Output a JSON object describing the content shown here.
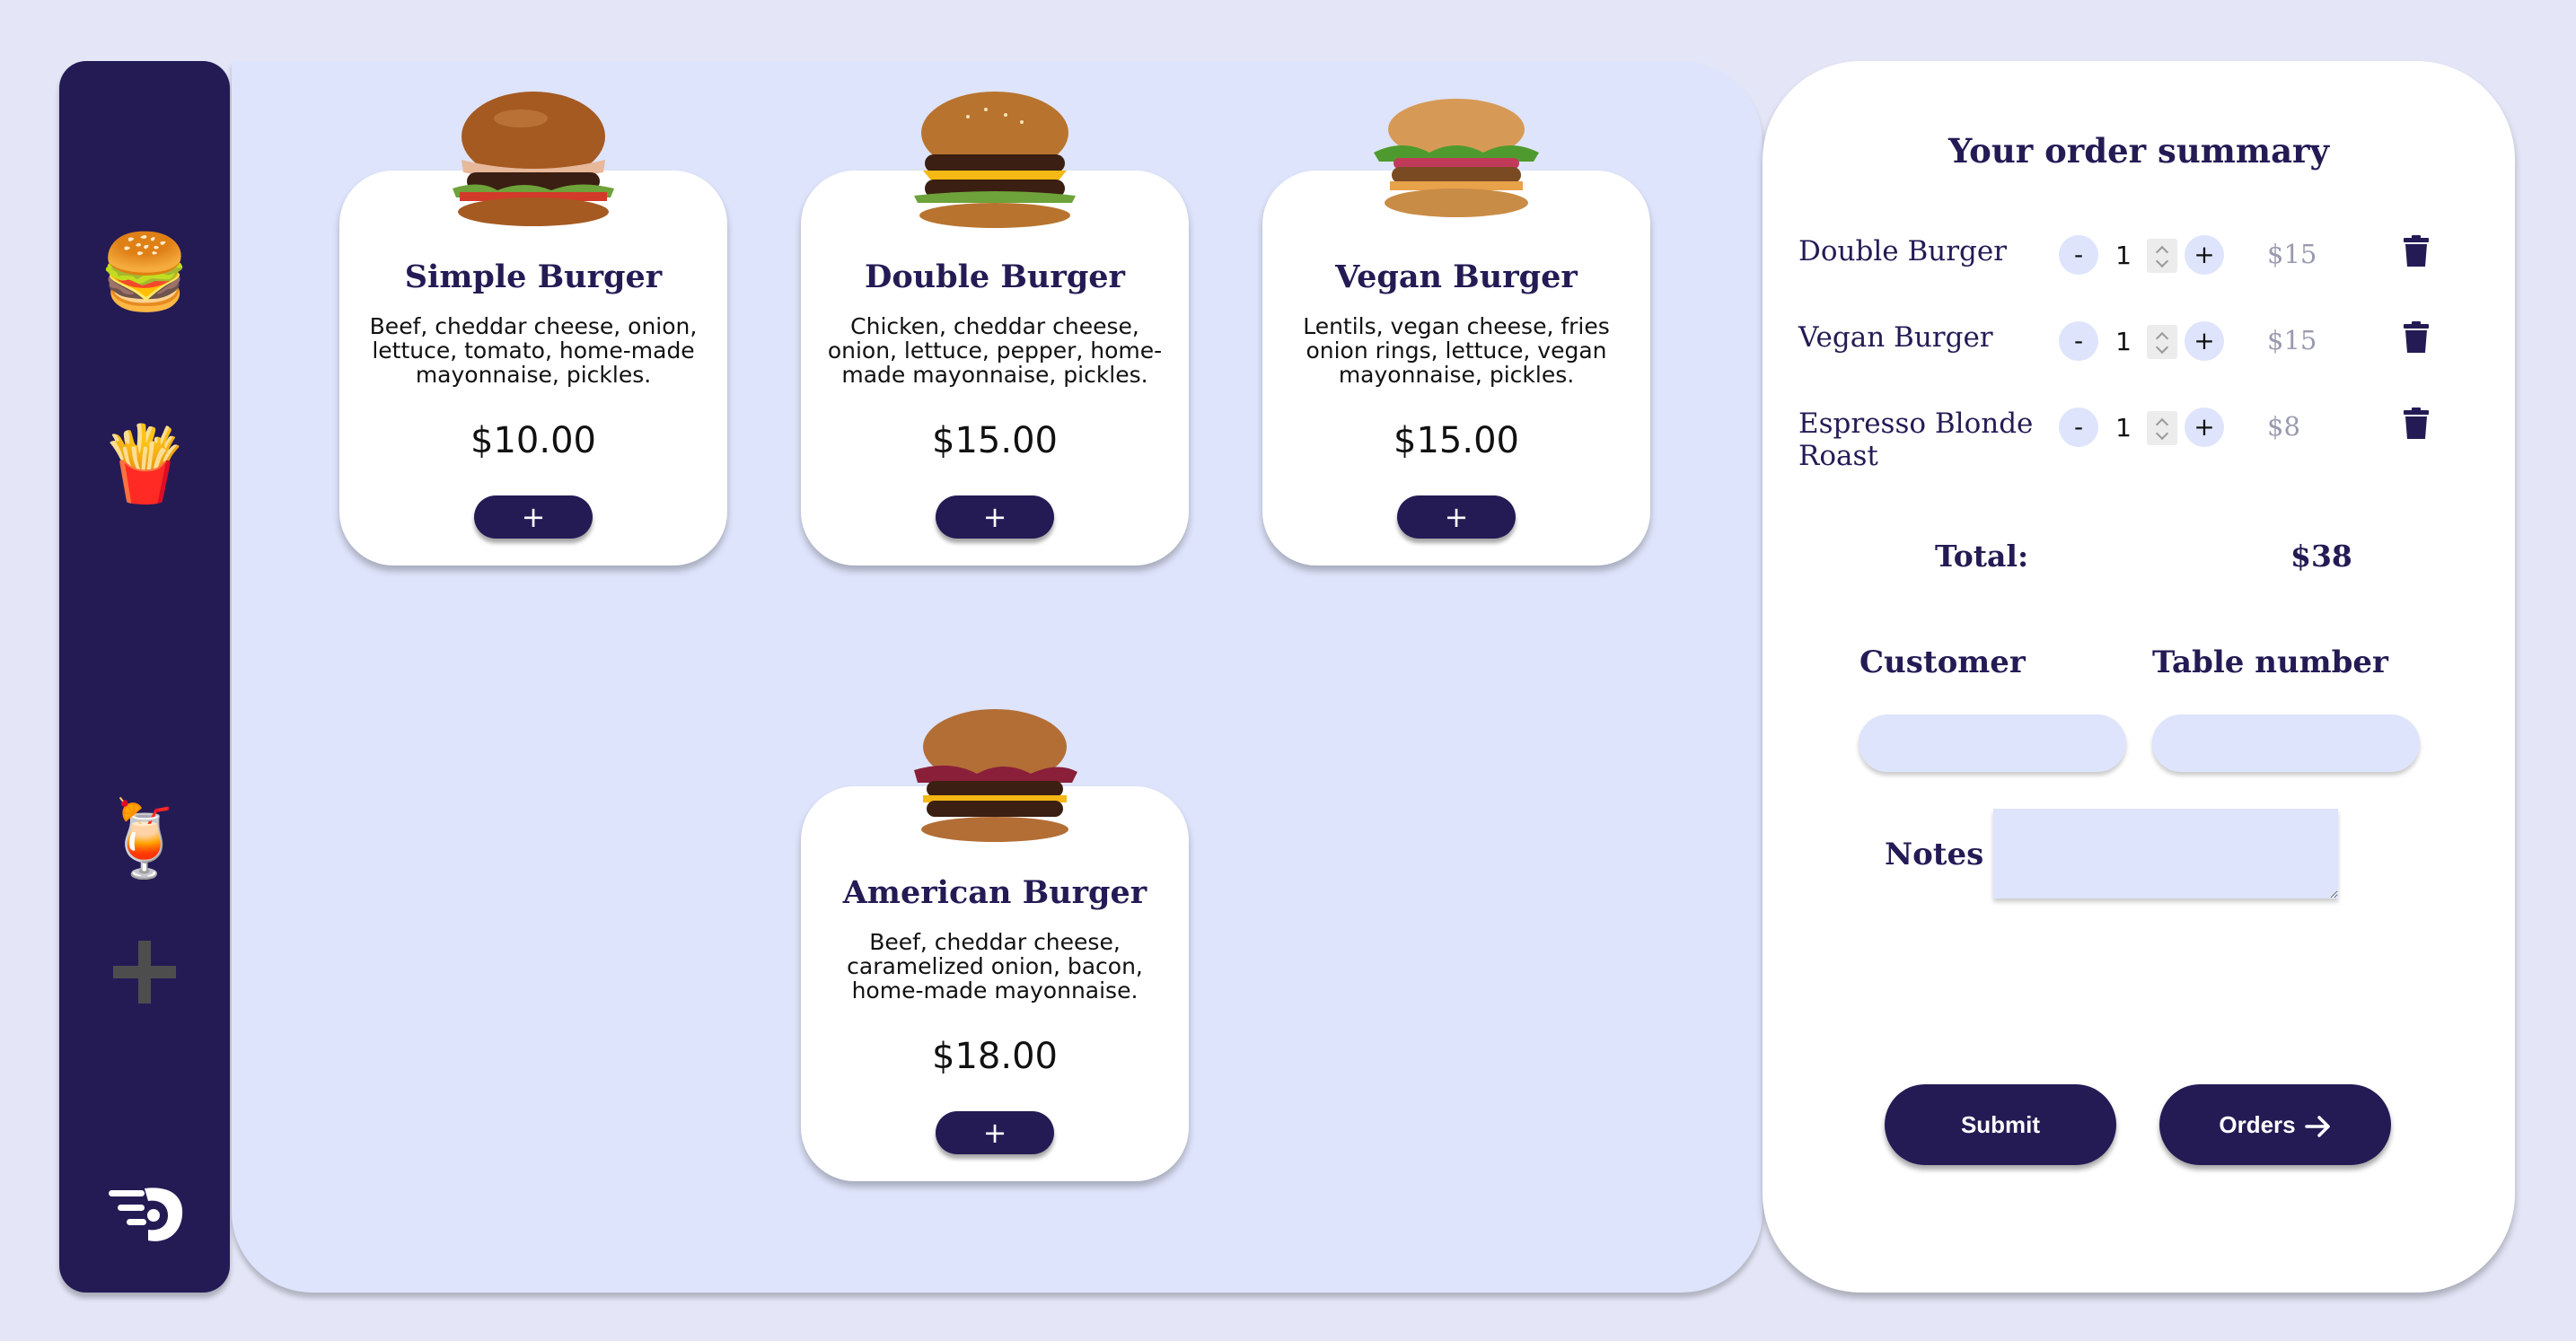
{
  "sidebar": {
    "items": [
      {
        "icon": "burger-icon",
        "glyph": "🍔"
      },
      {
        "icon": "fries-icon",
        "glyph": "🍟"
      },
      {
        "icon": "coffee-icon",
        "glyph": "☕"
      },
      {
        "icon": "cocktail-icon",
        "glyph": "🍹"
      },
      {
        "icon": "add-category-icon",
        "glyph": "+"
      }
    ],
    "logo": "logo-icon"
  },
  "menu": {
    "items": [
      {
        "name": "Simple Burger",
        "description": "Beef, cheddar cheese, onion, lettuce, tomato, home-made mayonnaise, pickles.",
        "price": "$10.00",
        "add_label": "+"
      },
      {
        "name": "Double Burger",
        "description": "Chicken, cheddar cheese, onion, lettuce, pepper, home-made mayonnaise, pickles.",
        "price": "$15.00",
        "add_label": "+"
      },
      {
        "name": "Vegan Burger",
        "description": "Lentils, vegan cheese, fries onion rings, lettuce, vegan mayonnaise, pickles.",
        "price": "$15.00",
        "add_label": "+"
      },
      {
        "name": "American Burger",
        "description": "Beef, cheddar cheese, caramelized onion, bacon, home-made mayonnaise.",
        "price": "$18.00",
        "add_label": "+"
      }
    ]
  },
  "order": {
    "title": "Your order summary",
    "items": [
      {
        "name": "Double Burger",
        "quantity": "1",
        "price": "$15",
        "minus": "-",
        "plus": "+"
      },
      {
        "name": "Vegan Burger",
        "quantity": "1",
        "price": "$15",
        "minus": "-",
        "plus": "+"
      },
      {
        "name": "Espresso Blonde Roast",
        "quantity": "1",
        "price": "$8",
        "minus": "-",
        "plus": "+"
      }
    ],
    "total_label": "Total:",
    "total_value": "$38",
    "customer_label": "Customer",
    "table_label": "Table number",
    "notes_label": "Notes",
    "submit_label": "Submit",
    "orders_label": "Orders"
  },
  "colors": {
    "brand": "#241b55",
    "background": "#e4e6f7",
    "panel": "#dee4fb",
    "muted_price": "#9a9ab0"
  }
}
